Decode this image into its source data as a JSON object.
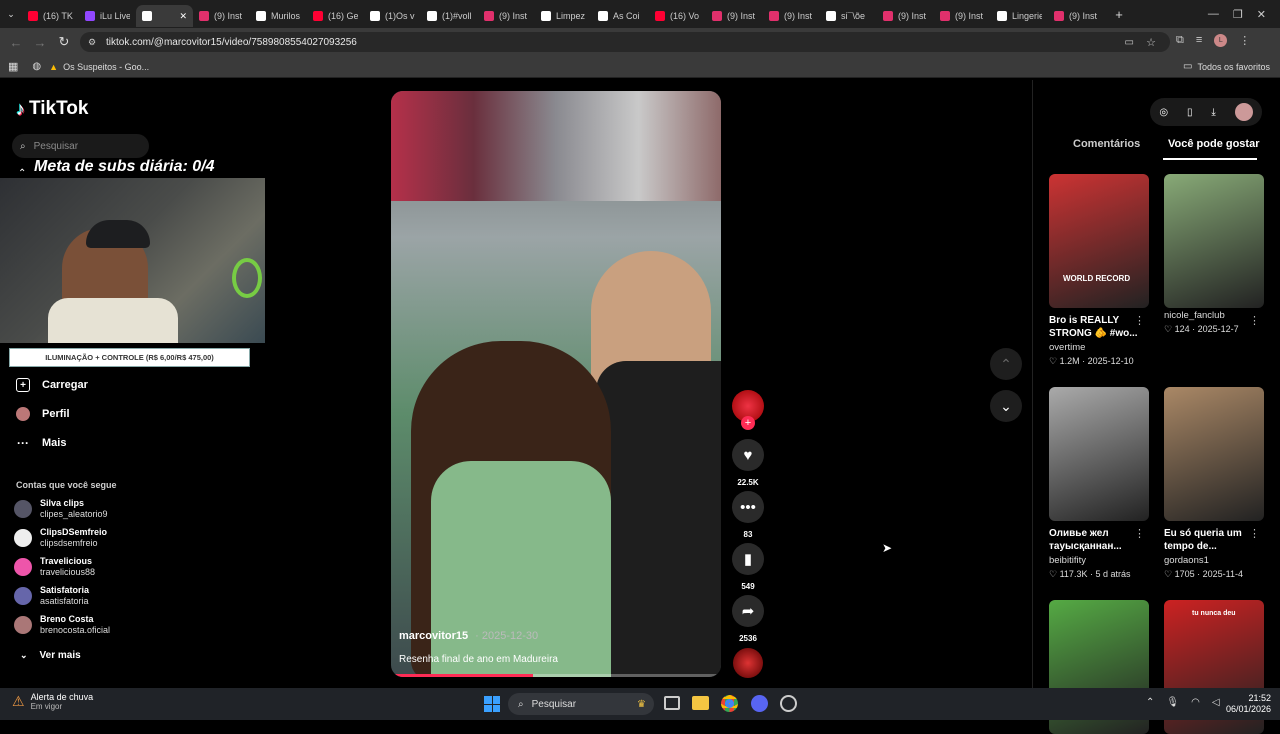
{
  "browser": {
    "tabs": [
      {
        "label": "(16) TK",
        "color": "#ff0033"
      },
      {
        "label": "iLu Live",
        "color": "#9147ff"
      },
      {
        "label": "",
        "color": "#ffffff",
        "active": true
      },
      {
        "label": "(9) Inst",
        "color": "#e1306c"
      },
      {
        "label": "Murilos",
        "color": "#ffffff"
      },
      {
        "label": "(16) Ge",
        "color": "#ff0033"
      },
      {
        "label": "(1)Os v",
        "color": "#ffffff"
      },
      {
        "label": "(1)#voll",
        "color": "#ffffff"
      },
      {
        "label": "(9) Inst",
        "color": "#e1306c"
      },
      {
        "label": "Limpez",
        "color": "#ffffff"
      },
      {
        "label": "As Coi",
        "color": "#ffffff"
      },
      {
        "label": "(16) Vo",
        "color": "#ff0033"
      },
      {
        "label": "(9) Inst",
        "color": "#e1306c"
      },
      {
        "label": "(9) Inst",
        "color": "#e1306c"
      },
      {
        "label": "si¯\\õe",
        "color": "#ffffff"
      },
      {
        "label": "(9) Inst",
        "color": "#e1306c"
      },
      {
        "label": "(9) Inst",
        "color": "#e1306c"
      },
      {
        "label": "Lingerie",
        "color": "#ffffff"
      },
      {
        "label": "(9) Inst",
        "color": "#e1306c"
      }
    ],
    "url": "tiktok.com/@marcovitor15/video/7589808554027093256",
    "bookmarks": {
      "item1": "Os Suspeitos - Goo...",
      "all": "Todos os favoritos"
    }
  },
  "sidebar": {
    "logo": "TikTok",
    "search_placeholder": "Pesquisar",
    "overlay_goal": "Meta de subs diária: 0/4",
    "sponsor": "ILUMINAÇÃO + CONTROLE (R$ 6,00/R$ 475,00)",
    "nav": {
      "upload": "Carregar",
      "profile": "Perfil",
      "more": "Mais"
    },
    "following_title": "Contas que você segue",
    "accounts": [
      {
        "name": "Silva clips",
        "handle": "clipes_aleatorio9",
        "color": "#556"
      },
      {
        "name": "ClipsDSemfreio",
        "handle": "clipsdsemfreio",
        "color": "#eee"
      },
      {
        "name": "Travelicious",
        "handle": "travelicious88",
        "color": "#e5a"
      },
      {
        "name": "Satisfatoria",
        "handle": "asatisfatoria",
        "color": "#66a"
      },
      {
        "name": "Breno Costa",
        "handle": "brenocosta.oficial",
        "color": "#a77"
      }
    ],
    "see_more": "Ver mais"
  },
  "video": {
    "username": "marcovitor15",
    "date": "2025-12-30",
    "caption": "Resenha final de ano em Madureira",
    "progress": 0.43,
    "likes": "22.5K",
    "comments": "83",
    "saves": "549",
    "shares": "2536"
  },
  "right": {
    "tabs": {
      "comments": "Comentários",
      "suggested": "Você pode gostar"
    },
    "cards": [
      {
        "title": "Bro is REALLY STRONG 🫵 #wo...",
        "author": "overtime",
        "likes": "1.2M",
        "date": "2025-12-10",
        "bg": "#c33"
      },
      {
        "title": "",
        "author": "nicole_fanclub",
        "likes": "124",
        "date": "2025-12-7",
        "bg": "#8a7"
      },
      {
        "title": "Оливье жел тауысқаннан...",
        "author": "beibitifity",
        "likes": "117.3K",
        "date": "5 d atrás",
        "bg": "#aaa"
      },
      {
        "title": "Eu só queria um tempo de...",
        "author": "gordaons1",
        "likes": "1705",
        "date": "2025-11-4",
        "bg": "#a86"
      },
      {
        "title": "",
        "author": "",
        "likes": "",
        "date": "",
        "bg": "#5a4"
      },
      {
        "title": "",
        "author": "",
        "likes": "",
        "date": "",
        "bg": "#c22",
        "overlay": "tu nunca deu"
      }
    ],
    "card1_overlay": "WORLD RECORD"
  },
  "taskbar": {
    "weather_title": "Alerta de chuva",
    "weather_sub": "Em vigor",
    "search": "Pesquisar",
    "time": "21:52",
    "date": "06/01/2026"
  }
}
